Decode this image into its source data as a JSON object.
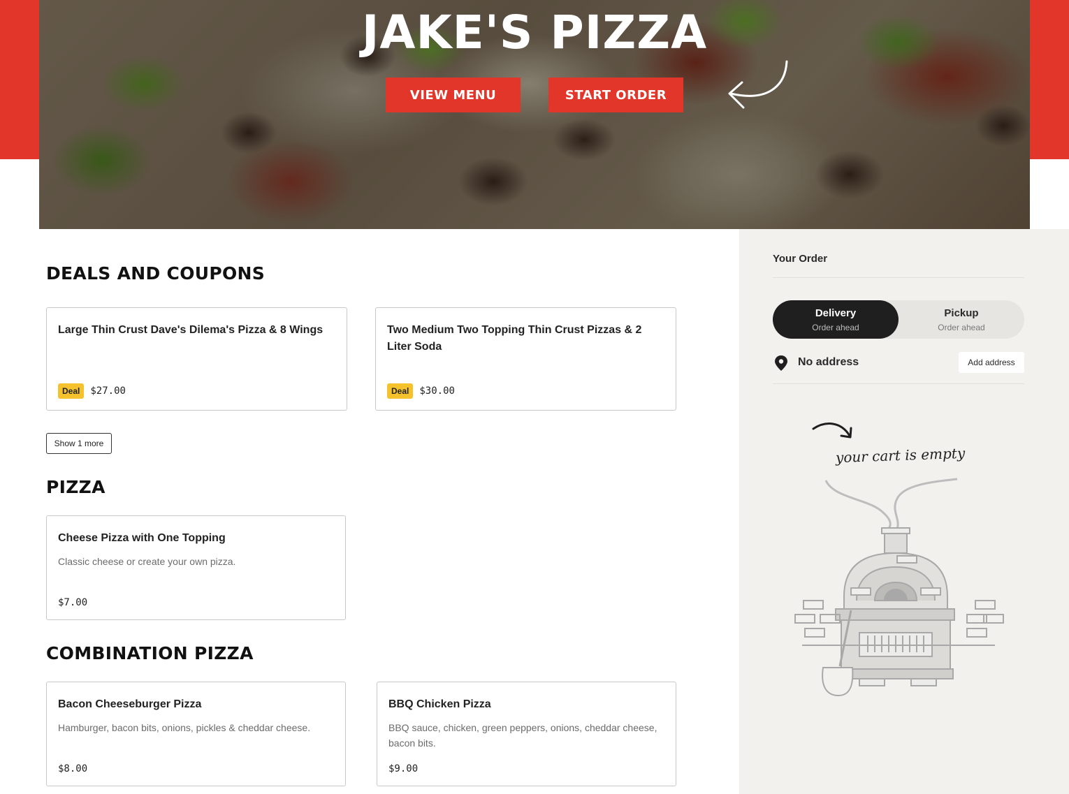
{
  "brand": {
    "accent": "#e2362a",
    "badge_color": "#f5c22e",
    "dark": "#1f1f1f"
  },
  "hero": {
    "title": "JAKE'S PIZZA",
    "view_menu_label": "VIEW MENU",
    "start_order_label": "START ORDER",
    "arrow_icon": "curved-arrow-icon"
  },
  "deals": {
    "heading": "DEALS AND COUPONS",
    "badge": "Deal",
    "items": [
      {
        "name": "Large Thin Crust Dave's Dilema's Pizza & 8 Wings",
        "price": "$27.00"
      },
      {
        "name": "Two Medium Two Topping Thin Crust Pizzas & 2 Liter Soda",
        "price": "$30.00"
      }
    ],
    "show_more_label": "Show 1 more"
  },
  "pizza": {
    "heading": "PIZZA",
    "items": [
      {
        "name": "Cheese Pizza with One Topping",
        "desc": "Classic cheese or create your own pizza.",
        "price": "$7.00"
      }
    ]
  },
  "combination": {
    "heading": "COMBINATION PIZZA",
    "items": [
      {
        "name": "Bacon Cheeseburger Pizza",
        "desc": "Hamburger, bacon bits, onions, pickles & cheddar cheese.",
        "price": "$8.00"
      },
      {
        "name": "BBQ Chicken Pizza",
        "desc": "BBQ sauce, chicken, green peppers, onions, cheddar cheese, bacon bits.",
        "price": "$9.00"
      }
    ]
  },
  "order": {
    "title": "Your Order",
    "delivery": {
      "label": "Delivery",
      "sub": "Order ahead"
    },
    "pickup": {
      "label": "Pickup",
      "sub": "Order ahead"
    },
    "address_text": "No address",
    "add_address_label": "Add address",
    "empty_text": "your cart is empty",
    "pin_icon": "location-pin-icon",
    "oven_icon": "pizza-oven-illustration"
  }
}
